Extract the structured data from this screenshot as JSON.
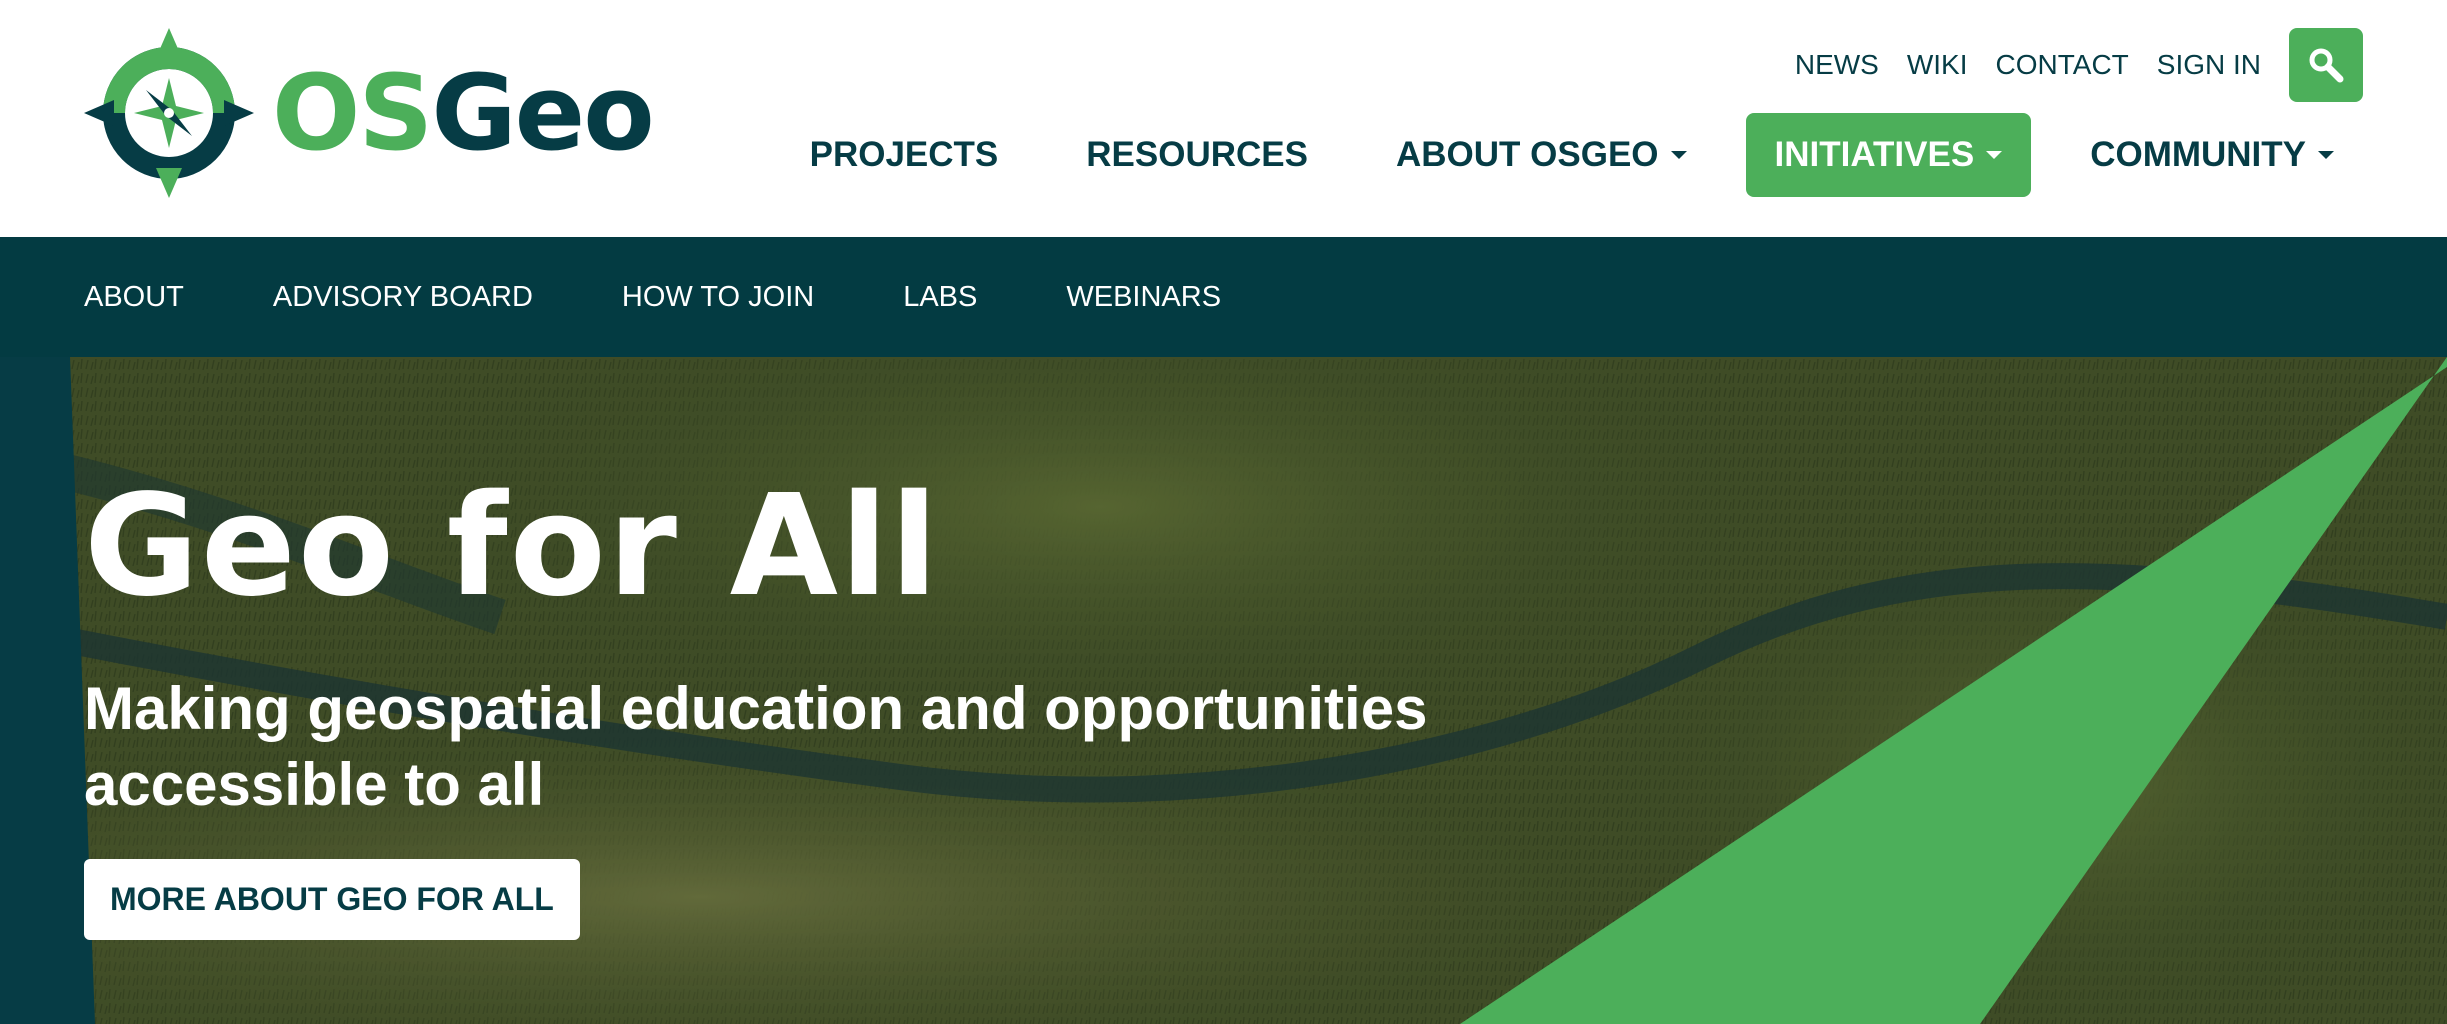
{
  "brand": {
    "logo_os": "OS",
    "logo_geo": "Geo",
    "colors": {
      "primary_green": "#4caf5a",
      "dark_teal": "#063c45",
      "subnav_bg": "#033b42"
    }
  },
  "utility_nav": {
    "items": [
      "NEWS",
      "WIKI",
      "CONTACT",
      "SIGN IN"
    ],
    "search_icon": "search-icon"
  },
  "main_nav": {
    "items": [
      {
        "label": "PROJECTS",
        "dropdown": false,
        "active": false
      },
      {
        "label": "RESOURCES",
        "dropdown": false,
        "active": false
      },
      {
        "label": "ABOUT OSGEO",
        "dropdown": true,
        "active": false
      },
      {
        "label": "INITIATIVES",
        "dropdown": true,
        "active": true
      },
      {
        "label": "COMMUNITY",
        "dropdown": true,
        "active": false
      }
    ]
  },
  "sub_nav": {
    "items": [
      "ABOUT",
      "ADVISORY BOARD",
      "HOW TO JOIN",
      "LABS",
      "WEBINARS"
    ]
  },
  "hero": {
    "title": "Geo for All",
    "subtitle": "Making geospatial education and opportunities accessible to all",
    "cta_label": "MORE ABOUT GEO FOR ALL"
  }
}
